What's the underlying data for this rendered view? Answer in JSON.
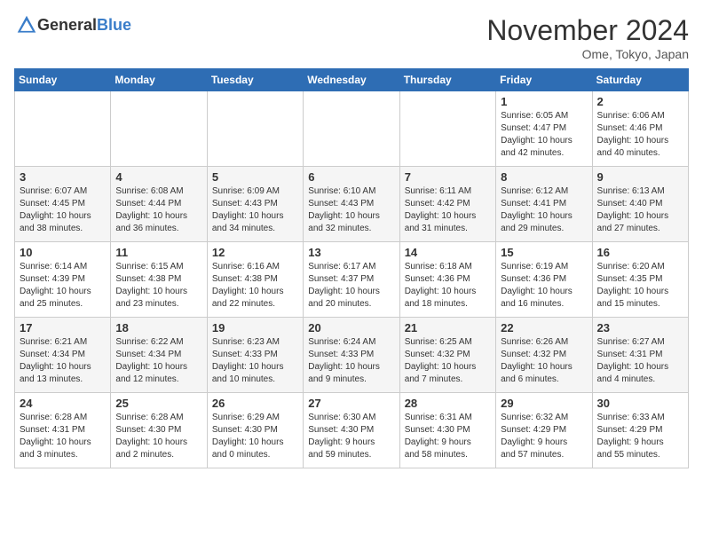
{
  "logo": {
    "text_general": "General",
    "text_blue": "Blue"
  },
  "title": "November 2024",
  "location": "Ome, Tokyo, Japan",
  "weekdays": [
    "Sunday",
    "Monday",
    "Tuesday",
    "Wednesday",
    "Thursday",
    "Friday",
    "Saturday"
  ],
  "weeks": [
    [
      {
        "day": "",
        "info": ""
      },
      {
        "day": "",
        "info": ""
      },
      {
        "day": "",
        "info": ""
      },
      {
        "day": "",
        "info": ""
      },
      {
        "day": "",
        "info": ""
      },
      {
        "day": "1",
        "info": "Sunrise: 6:05 AM\nSunset: 4:47 PM\nDaylight: 10 hours\nand 42 minutes."
      },
      {
        "day": "2",
        "info": "Sunrise: 6:06 AM\nSunset: 4:46 PM\nDaylight: 10 hours\nand 40 minutes."
      }
    ],
    [
      {
        "day": "3",
        "info": "Sunrise: 6:07 AM\nSunset: 4:45 PM\nDaylight: 10 hours\nand 38 minutes."
      },
      {
        "day": "4",
        "info": "Sunrise: 6:08 AM\nSunset: 4:44 PM\nDaylight: 10 hours\nand 36 minutes."
      },
      {
        "day": "5",
        "info": "Sunrise: 6:09 AM\nSunset: 4:43 PM\nDaylight: 10 hours\nand 34 minutes."
      },
      {
        "day": "6",
        "info": "Sunrise: 6:10 AM\nSunset: 4:43 PM\nDaylight: 10 hours\nand 32 minutes."
      },
      {
        "day": "7",
        "info": "Sunrise: 6:11 AM\nSunset: 4:42 PM\nDaylight: 10 hours\nand 31 minutes."
      },
      {
        "day": "8",
        "info": "Sunrise: 6:12 AM\nSunset: 4:41 PM\nDaylight: 10 hours\nand 29 minutes."
      },
      {
        "day": "9",
        "info": "Sunrise: 6:13 AM\nSunset: 4:40 PM\nDaylight: 10 hours\nand 27 minutes."
      }
    ],
    [
      {
        "day": "10",
        "info": "Sunrise: 6:14 AM\nSunset: 4:39 PM\nDaylight: 10 hours\nand 25 minutes."
      },
      {
        "day": "11",
        "info": "Sunrise: 6:15 AM\nSunset: 4:38 PM\nDaylight: 10 hours\nand 23 minutes."
      },
      {
        "day": "12",
        "info": "Sunrise: 6:16 AM\nSunset: 4:38 PM\nDaylight: 10 hours\nand 22 minutes."
      },
      {
        "day": "13",
        "info": "Sunrise: 6:17 AM\nSunset: 4:37 PM\nDaylight: 10 hours\nand 20 minutes."
      },
      {
        "day": "14",
        "info": "Sunrise: 6:18 AM\nSunset: 4:36 PM\nDaylight: 10 hours\nand 18 minutes."
      },
      {
        "day": "15",
        "info": "Sunrise: 6:19 AM\nSunset: 4:36 PM\nDaylight: 10 hours\nand 16 minutes."
      },
      {
        "day": "16",
        "info": "Sunrise: 6:20 AM\nSunset: 4:35 PM\nDaylight: 10 hours\nand 15 minutes."
      }
    ],
    [
      {
        "day": "17",
        "info": "Sunrise: 6:21 AM\nSunset: 4:34 PM\nDaylight: 10 hours\nand 13 minutes."
      },
      {
        "day": "18",
        "info": "Sunrise: 6:22 AM\nSunset: 4:34 PM\nDaylight: 10 hours\nand 12 minutes."
      },
      {
        "day": "19",
        "info": "Sunrise: 6:23 AM\nSunset: 4:33 PM\nDaylight: 10 hours\nand 10 minutes."
      },
      {
        "day": "20",
        "info": "Sunrise: 6:24 AM\nSunset: 4:33 PM\nDaylight: 10 hours\nand 9 minutes."
      },
      {
        "day": "21",
        "info": "Sunrise: 6:25 AM\nSunset: 4:32 PM\nDaylight: 10 hours\nand 7 minutes."
      },
      {
        "day": "22",
        "info": "Sunrise: 6:26 AM\nSunset: 4:32 PM\nDaylight: 10 hours\nand 6 minutes."
      },
      {
        "day": "23",
        "info": "Sunrise: 6:27 AM\nSunset: 4:31 PM\nDaylight: 10 hours\nand 4 minutes."
      }
    ],
    [
      {
        "day": "24",
        "info": "Sunrise: 6:28 AM\nSunset: 4:31 PM\nDaylight: 10 hours\nand 3 minutes."
      },
      {
        "day": "25",
        "info": "Sunrise: 6:28 AM\nSunset: 4:30 PM\nDaylight: 10 hours\nand 2 minutes."
      },
      {
        "day": "26",
        "info": "Sunrise: 6:29 AM\nSunset: 4:30 PM\nDaylight: 10 hours\nand 0 minutes."
      },
      {
        "day": "27",
        "info": "Sunrise: 6:30 AM\nSunset: 4:30 PM\nDaylight: 9 hours\nand 59 minutes."
      },
      {
        "day": "28",
        "info": "Sunrise: 6:31 AM\nSunset: 4:30 PM\nDaylight: 9 hours\nand 58 minutes."
      },
      {
        "day": "29",
        "info": "Sunrise: 6:32 AM\nSunset: 4:29 PM\nDaylight: 9 hours\nand 57 minutes."
      },
      {
        "day": "30",
        "info": "Sunrise: 6:33 AM\nSunset: 4:29 PM\nDaylight: 9 hours\nand 55 minutes."
      }
    ]
  ]
}
